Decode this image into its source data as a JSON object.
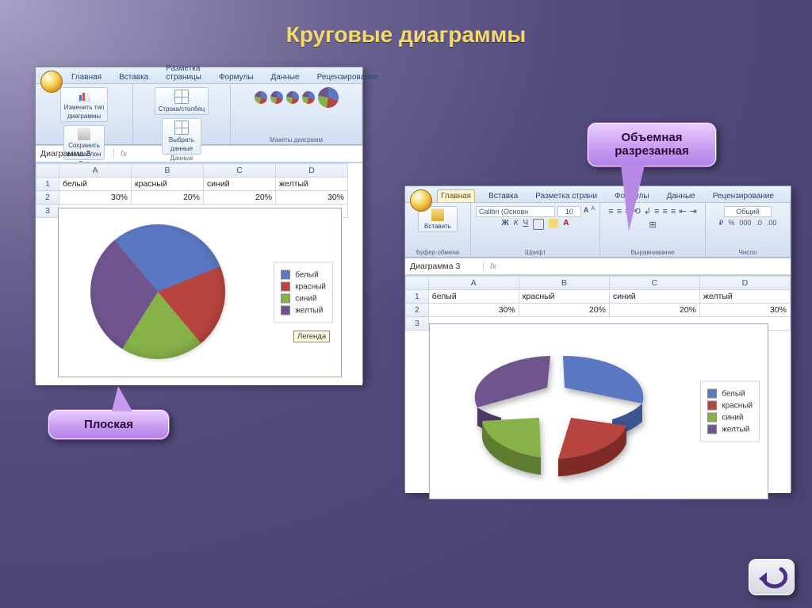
{
  "slide": {
    "title": "Круговые диаграммы"
  },
  "callouts": {
    "flat": "Плоская",
    "exploded_line1": "Объемная",
    "exploded_line2": "разрезанная"
  },
  "excel_left": {
    "tabs": [
      "Главная",
      "Вставка",
      "Разметка страницы",
      "Формулы",
      "Данные",
      "Рецензирование"
    ],
    "groups": {
      "type": "Тип",
      "data": "Данные",
      "layouts": "Макеты диаграмм",
      "change_type_l1": "Изменить тип",
      "change_type_l2": "диаграммы",
      "save_tpl_l1": "Сохранить",
      "save_tpl_l2": "как шаблон",
      "rowcol": "Строка/столбец",
      "select_l1": "Выбрать",
      "select_l2": "данные"
    },
    "namebox": "Диаграмма 3",
    "fx": "fx",
    "cols": [
      "",
      "A",
      "B",
      "C",
      "D"
    ],
    "row1": [
      "1",
      "белый",
      "красный",
      "синий",
      "желтый"
    ],
    "row2": [
      "2",
      "30%",
      "20%",
      "20%",
      "30%"
    ],
    "tooltip": "Легенда"
  },
  "excel_right": {
    "tabs": [
      "Главная",
      "Вставка",
      "Разметка страни",
      "Формулы",
      "Данные",
      "Рецензирование"
    ],
    "groups": {
      "clipboard": "Буфер обмена",
      "font": "Шрифт",
      "align": "Выравнивание",
      "number": "Число",
      "font_name": "Calibri (Основн",
      "font_size": "10",
      "num_fmt": "Общий",
      "paste": "Вставить",
      "percent": "%",
      "thousand": "000"
    },
    "namebox": "Диаграмма 3",
    "fx": "fx",
    "cols": [
      "",
      "A",
      "B",
      "C",
      "D"
    ],
    "row1": [
      "1",
      "белый",
      "красный",
      "синий",
      "желтый"
    ],
    "row2": [
      "2",
      "30%",
      "20%",
      "20%",
      "30%"
    ]
  },
  "legend": {
    "items": [
      "белый",
      "красный",
      "синий",
      "желтый"
    ]
  },
  "colors": {
    "white": "#5a77c2",
    "red": "#b8443f",
    "blue": "#87b24a",
    "yellow": "#6f548e"
  },
  "chart_data": [
    {
      "type": "pie",
      "title": "Плоская",
      "categories": [
        "белый",
        "красный",
        "синий",
        "желтый"
      ],
      "values": [
        30,
        20,
        20,
        30
      ],
      "series": [
        {
          "name": "",
          "values": [
            30,
            20,
            20,
            30
          ]
        }
      ],
      "colors": [
        "#5a77c2",
        "#b8443f",
        "#87b24a",
        "#6f548e"
      ],
      "exploded": false,
      "three_d": false
    },
    {
      "type": "pie",
      "title": "Объемная разрезанная",
      "categories": [
        "белый",
        "красный",
        "синий",
        "желтый"
      ],
      "values": [
        30,
        20,
        20,
        30
      ],
      "series": [
        {
          "name": "",
          "values": [
            30,
            20,
            20,
            30
          ]
        }
      ],
      "colors": [
        "#5a77c2",
        "#b8443f",
        "#87b24a",
        "#6f548e"
      ],
      "exploded": true,
      "three_d": true
    }
  ]
}
